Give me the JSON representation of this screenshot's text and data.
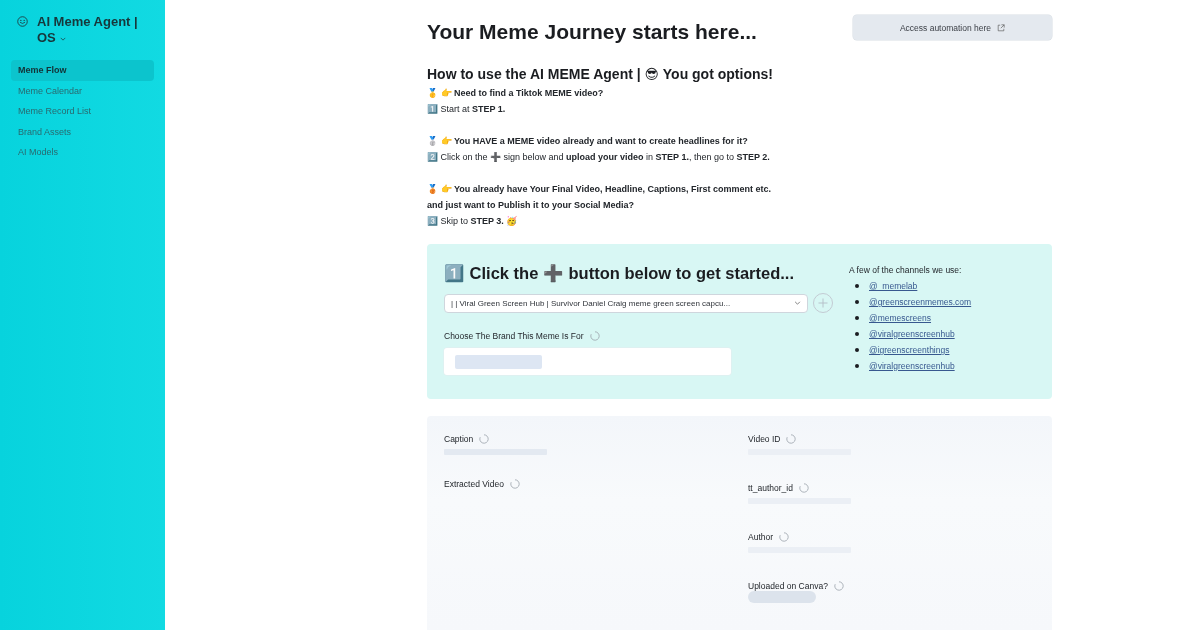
{
  "sidebar": {
    "title": "AI Meme Agent | OS",
    "items": [
      {
        "label": "Meme Flow",
        "selected": true
      },
      {
        "label": "Meme Calendar",
        "selected": false
      },
      {
        "label": "Meme Record List",
        "selected": false
      },
      {
        "label": "Brand Assets",
        "selected": false
      },
      {
        "label": "AI Models",
        "selected": false
      }
    ]
  },
  "header": {
    "title": "Your Meme Journey starts here...",
    "automation_button": "Access automation here"
  },
  "guide": {
    "heading": "How to use the AI MEME Agent | 😎 You got options!",
    "options": [
      {
        "lines": [
          "🥇 👉 **Need to find a Tiktok MEME video?**",
          "1️⃣ Start at **STEP 1.**"
        ]
      },
      {
        "lines": [
          "🥈 👉 **You HAVE a MEME video already and want to create headlines for it?**",
          "2️⃣ Click on the ➕ sign below and **upload your video** in **STEP 1.**, then go to **STEP 2.**"
        ]
      },
      {
        "lines": [
          "🥉 👉 **You already have Your Final Video, Headline, Captions, First comment etc.**",
          "**and just want to Publish it to your Social Media?**",
          "3️⃣ Skip to **STEP 3.** 🥳"
        ]
      }
    ]
  },
  "step_card": {
    "heading": "1️⃣ Click the ➕ button below to get started...",
    "video_select": {
      "value": "| | Viral Green Screen Hub | Survivor Daniel Craig meme green screen capcu..."
    },
    "brand_field": {
      "label": "Choose The Brand This Meme Is For",
      "loading": true
    },
    "channels": {
      "title": "A few of the channels we use:",
      "links": [
        "@_memelab",
        "@greenscreenmemes.com",
        "@memescreens",
        "@viralgreenscreenhub",
        "@igreenscreenthings",
        "@viralgreenscreenhub"
      ]
    }
  },
  "details": {
    "left": [
      {
        "label": "Caption",
        "loading": true,
        "kind": "text"
      },
      {
        "label": "Extracted Video",
        "loading": true,
        "kind": "media"
      }
    ],
    "right": [
      {
        "label": "Video ID",
        "loading": true,
        "kind": "text"
      },
      {
        "label": "tt_author_id",
        "loading": true,
        "kind": "text"
      },
      {
        "label": "Author",
        "loading": true,
        "kind": "text"
      },
      {
        "label": "Uploaded on Canva?",
        "loading": true,
        "kind": "pill"
      }
    ]
  }
}
